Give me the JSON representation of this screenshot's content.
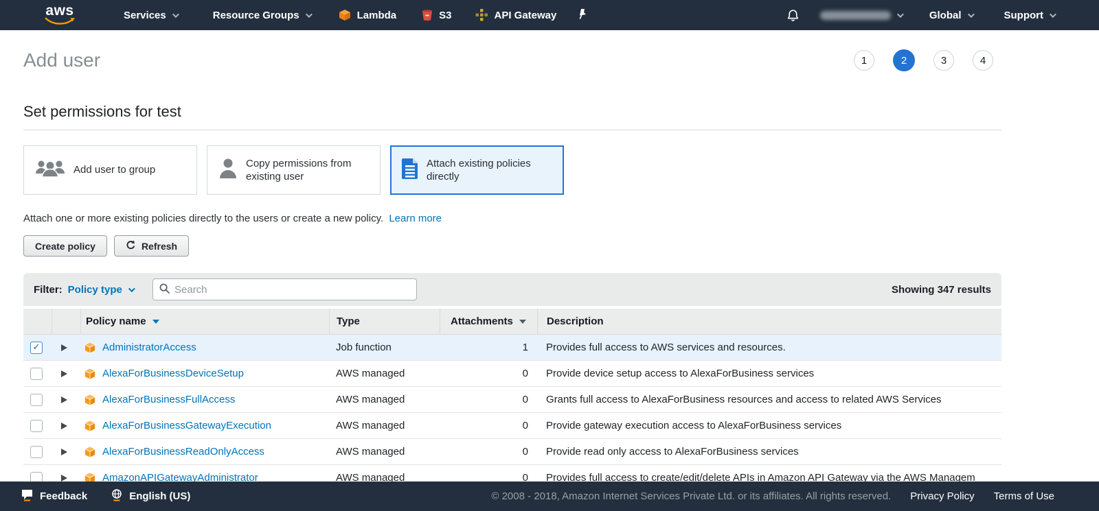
{
  "nav": {
    "logo_text": "aws",
    "items": [
      {
        "label": "Services"
      },
      {
        "label": "Resource Groups"
      },
      {
        "label": "Lambda"
      },
      {
        "label": "S3"
      },
      {
        "label": "API Gateway"
      }
    ],
    "global_label": "Global",
    "support_label": "Support"
  },
  "page": {
    "title": "Add user",
    "steps": [
      "1",
      "2",
      "3",
      "4"
    ],
    "active_step": "2",
    "section_heading": "Set permissions for test"
  },
  "options": [
    {
      "label": "Add user to group",
      "icon": "group-icon",
      "selected": false
    },
    {
      "label": "Copy permissions from existing user",
      "icon": "single-user-icon",
      "selected": false
    },
    {
      "label": "Attach existing policies directly",
      "icon": "document-icon",
      "selected": true
    }
  ],
  "help": {
    "text": "Attach one or more existing policies directly to the users or create a new policy.",
    "learn_more": "Learn more"
  },
  "toolbar": {
    "create_policy": "Create policy",
    "refresh": "Refresh"
  },
  "filter": {
    "label": "Filter:",
    "type": "Policy type",
    "search_placeholder": "Search",
    "results": "Showing 347 results"
  },
  "table": {
    "columns": [
      "Policy name",
      "Type",
      "Attachments",
      "Description"
    ],
    "rows": [
      {
        "checked": true,
        "name": "AdministratorAccess",
        "type": "Job function",
        "attachments": "1",
        "description": "Provides full access to AWS services and resources."
      },
      {
        "checked": false,
        "name": "AlexaForBusinessDeviceSetup",
        "type": "AWS managed",
        "attachments": "0",
        "description": "Provide device setup access to AlexaForBusiness services"
      },
      {
        "checked": false,
        "name": "AlexaForBusinessFullAccess",
        "type": "AWS managed",
        "attachments": "0",
        "description": "Grants full access to AlexaForBusiness resources and access to related AWS Services"
      },
      {
        "checked": false,
        "name": "AlexaForBusinessGatewayExecution",
        "type": "AWS managed",
        "attachments": "0",
        "description": "Provide gateway execution access to AlexaForBusiness services"
      },
      {
        "checked": false,
        "name": "AlexaForBusinessReadOnlyAccess",
        "type": "AWS managed",
        "attachments": "0",
        "description": "Provide read only access to AlexaForBusiness services"
      },
      {
        "checked": false,
        "name": "AmazonAPIGatewayAdministrator",
        "type": "AWS managed",
        "attachments": "0",
        "description": "Provides full access to create/edit/delete APIs in Amazon API Gateway via the AWS Managem"
      }
    ]
  },
  "footer": {
    "feedback": "Feedback",
    "language": "English (US)",
    "copyright": "© 2008 - 2018, Amazon Internet Services Private Ltd. or its affiliates. All rights reserved.",
    "privacy": "Privacy Policy",
    "terms": "Terms of Use"
  },
  "colors": {
    "nav_bg": "#232f3e",
    "accent_orange": "#ff9900",
    "link_blue": "#0073bb",
    "active_step_blue": "#2273d2",
    "selected_card_border": "#2074d5",
    "selected_card_bg": "#e9f3fc",
    "selected_row_bg": "#e7f2fc",
    "lambda_orange": "#e8831d",
    "s3_red": "#dd4f41",
    "apigw_gold": "#bc9b39",
    "policy_cube_orange": "#f5991d"
  }
}
